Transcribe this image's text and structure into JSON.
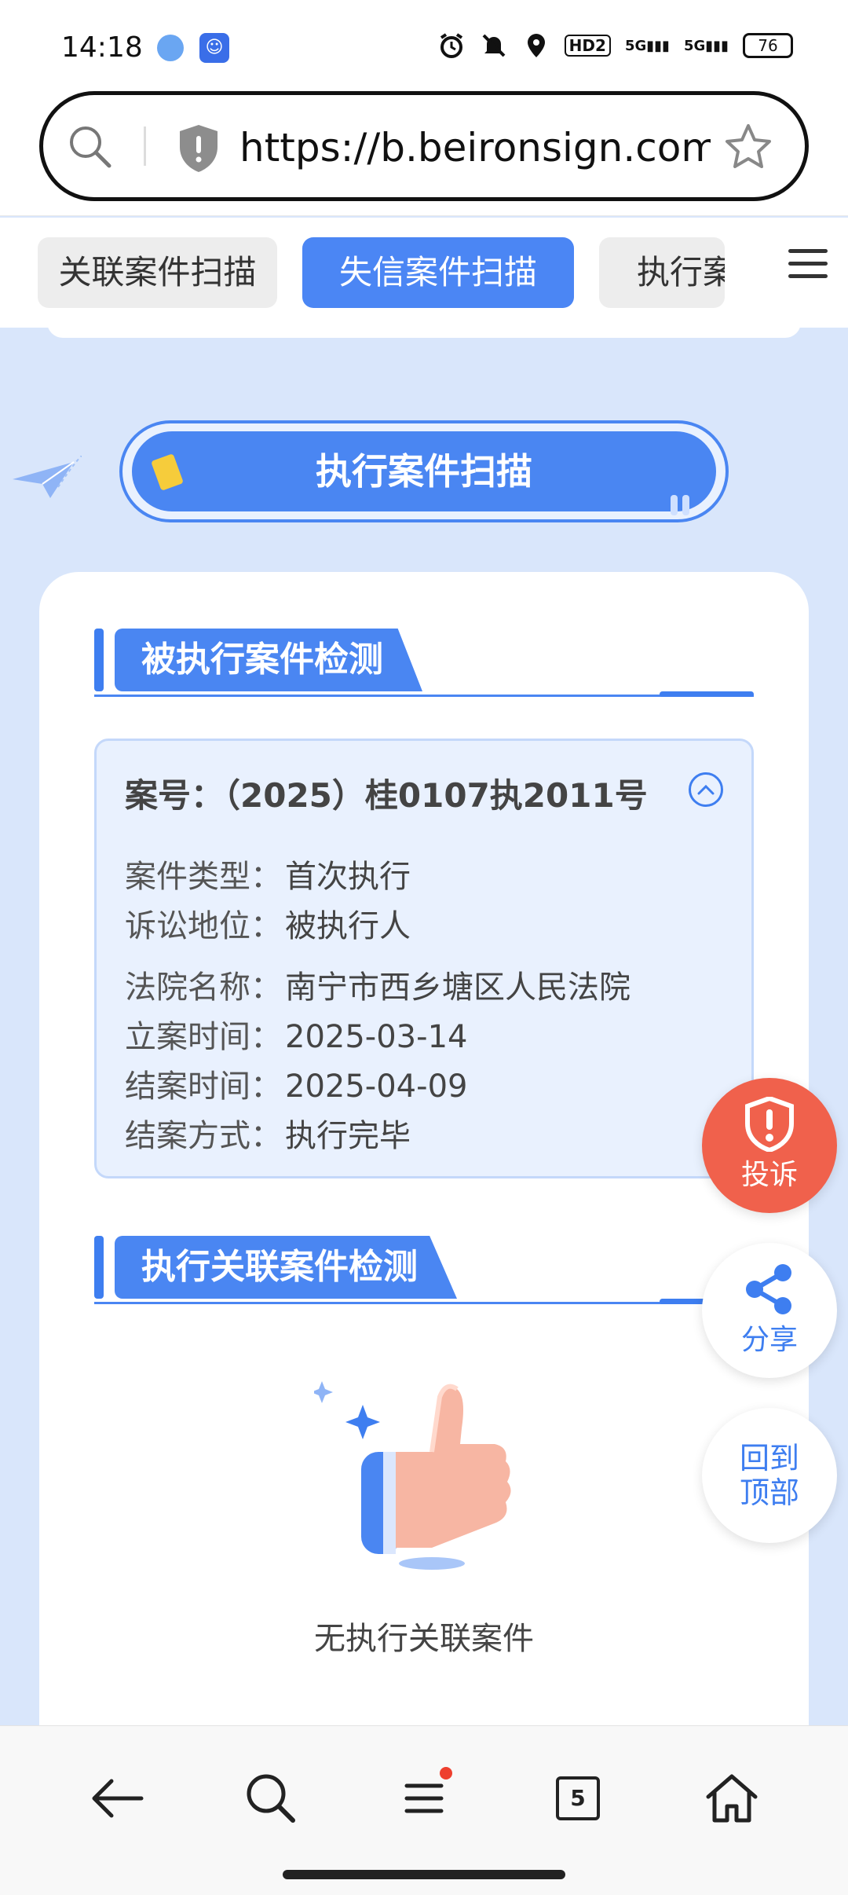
{
  "status_bar": {
    "time": "14:18",
    "battery": "76",
    "network_1": "5G",
    "network_2": "5G",
    "hd_badge": "HD2",
    "icons": [
      "alarm-icon",
      "mute-icon",
      "location-icon"
    ]
  },
  "address_bar": {
    "url": "https://b.beironsign.com..."
  },
  "tabs": [
    {
      "label": "关联案件扫描",
      "active": false
    },
    {
      "label": "失信案件扫描",
      "active": true
    },
    {
      "label": "执行案",
      "active": false
    }
  ],
  "banner": {
    "title": "执行案件扫描"
  },
  "section1": {
    "title": "被执行案件检测",
    "case": {
      "case_no_label": "案号：",
      "case_no": "（2025）桂0107执2011号",
      "fields": [
        {
          "key": "案件类型：",
          "value": "首次执行"
        },
        {
          "key": "诉讼地位：",
          "value": "被执行人"
        },
        {
          "key": "法院名称：",
          "value": "南宁市西乡塘区人民法院"
        },
        {
          "key": "立案时间：",
          "value": "2025-03-14"
        },
        {
          "key": "结案时间：",
          "value": "2025-04-09"
        },
        {
          "key": "结案方式：",
          "value": "执行完毕"
        }
      ]
    }
  },
  "section2": {
    "title": "执行关联案件检测",
    "empty_text": "无执行关联案件"
  },
  "fabs": {
    "complain": "投诉",
    "share": "分享",
    "back_to_top_1": "回到",
    "back_to_top_2": "顶部"
  },
  "bottom_nav": {
    "tab_count": "5"
  },
  "colors": {
    "accent": "#4a86f2",
    "complain": "#f0614c",
    "page_bg": "#d9e6fb"
  }
}
